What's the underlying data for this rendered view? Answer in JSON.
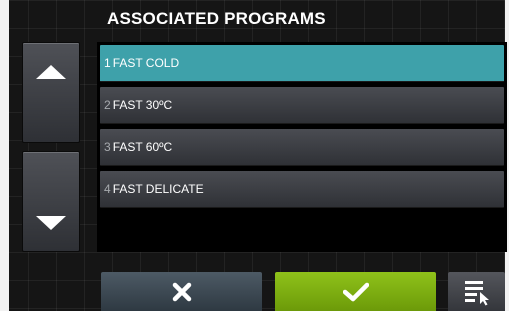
{
  "header": {
    "title": "ASSOCIATED PROGRAMS"
  },
  "nav": {
    "up_icon": "arrow-up-icon",
    "down_icon": "arrow-down-icon"
  },
  "programs": [
    {
      "num": "1",
      "label": "FAST COLD",
      "selected": true
    },
    {
      "num": "2",
      "label": "FAST 30ºC",
      "selected": false
    },
    {
      "num": "3",
      "label": "FAST 60ºC",
      "selected": false
    },
    {
      "num": "4",
      "label": "FAST DELICATE",
      "selected": false
    }
  ],
  "actions": {
    "cancel_icon": "close-icon",
    "confirm_icon": "check-icon",
    "menu_icon": "list-select-icon"
  },
  "colors": {
    "selected": "#3ea1aa",
    "confirm": "#7fb014",
    "cancel": "#3f4b55",
    "background": "#151515"
  }
}
